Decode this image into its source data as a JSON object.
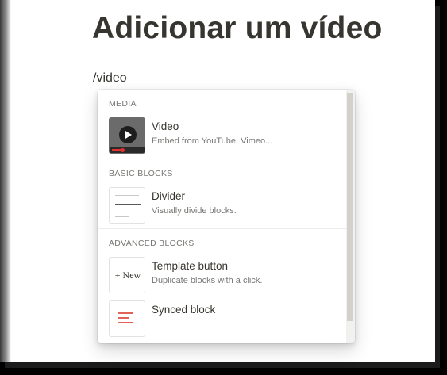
{
  "page": {
    "title": "Adicionar um vídeo",
    "command": "/video"
  },
  "menu": {
    "sections": [
      {
        "label": "MEDIA",
        "items": [
          {
            "title": "Video",
            "desc": "Embed from YouTube, Vimeo...",
            "icon": "video-thumbnail-icon"
          }
        ]
      },
      {
        "label": "BASIC BLOCKS",
        "items": [
          {
            "title": "Divider",
            "desc": "Visually divide blocks.",
            "icon": "divider-icon"
          }
        ]
      },
      {
        "label": "ADVANCED BLOCKS",
        "items": [
          {
            "title": "Template button",
            "desc": "Duplicate blocks with a click.",
            "icon": "template-button-icon",
            "icon_text": "+ New"
          },
          {
            "title": "Synced block",
            "desc": "",
            "icon": "synced-block-icon"
          }
        ]
      }
    ]
  },
  "colors": {
    "text": "#37352f",
    "muted": "#787774",
    "accent_red": "#e16259"
  }
}
